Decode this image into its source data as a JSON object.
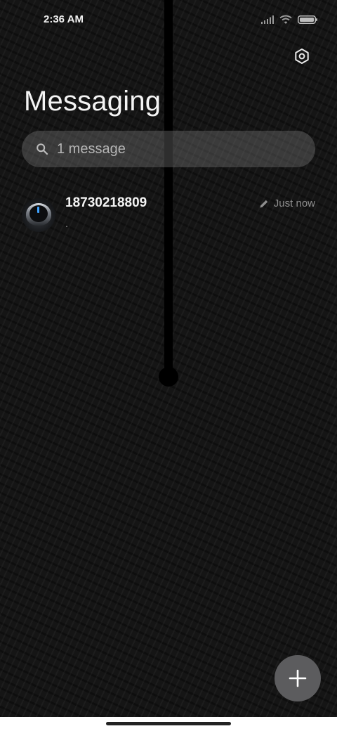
{
  "status_bar": {
    "time": "2:36 AM",
    "icons": [
      "signal-icon",
      "wifi-icon",
      "battery-icon"
    ]
  },
  "header": {
    "title": "Messaging",
    "settings_icon": "settings-icon"
  },
  "search": {
    "text": "1 message",
    "icon": "search-icon"
  },
  "conversations": [
    {
      "name": "18730218809",
      "snippet": ".",
      "time": "Just now",
      "status_icon": "pencil-icon"
    }
  ],
  "fab": {
    "icon": "plus-icon"
  }
}
